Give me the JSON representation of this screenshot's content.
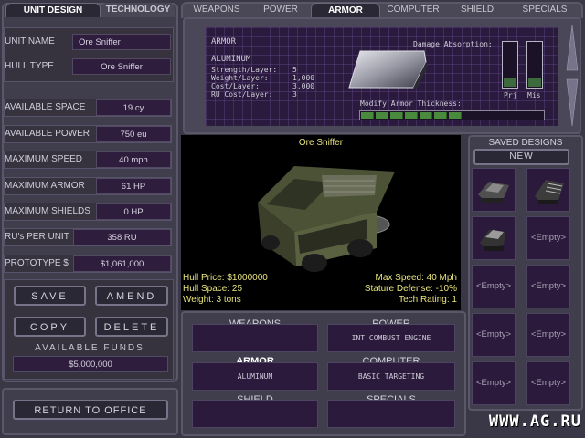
{
  "left": {
    "tab_active": "UNIT DESIGN",
    "tab_inactive": "TECHNOLOGY",
    "unit_name_label": "UNIT NAME",
    "unit_name_value": "Ore Sniffer",
    "hull_type_label": "HULL TYPE",
    "hull_type_value": "Ore Sniffer",
    "stats": [
      {
        "label": "AVAILABLE SPACE",
        "value": "19 cy"
      },
      {
        "label": "AVAILABLE POWER",
        "value": "750 eu"
      },
      {
        "label": "MAXIMUM SPEED",
        "value": "40 mph"
      },
      {
        "label": "MAXIMUM ARMOR",
        "value": "61 HP"
      },
      {
        "label": "MAXIMUM SHIELDS",
        "value": "0 HP"
      },
      {
        "label": "RU's PER UNIT",
        "value": "358 RU"
      },
      {
        "label": "PROTOTYPE $",
        "value": "$1,061,000"
      }
    ],
    "save": "SAVE",
    "amend": "AMEND",
    "copy": "COPY",
    "delete": "DELETE",
    "funds_label": "AVAILABLE FUNDS",
    "funds_value": "$5,000,000",
    "return": "RETURN TO OFFICE"
  },
  "tabs": [
    "WEAPONS",
    "POWER",
    "ARMOR",
    "COMPUTER",
    "SHIELD",
    "SPECIALS"
  ],
  "armor": {
    "heading": "ARMOR",
    "name": "ALUMINUM",
    "props": [
      {
        "label": "Strength/Layer:",
        "value": "5"
      },
      {
        "label": "Weight/Layer:",
        "value": "1,000"
      },
      {
        "label": "Cost/Layer:",
        "value": "3,000"
      },
      {
        "label": "RU Cost/Layer:",
        "value": "3"
      }
    ],
    "damage_label": "Damage Absorption:",
    "prj_label": "Prj",
    "mis_label": "Mis",
    "thickness_label": "Modify Armor Thickness:",
    "thickness_fraction": 0.6
  },
  "viewer": {
    "unit_title": "Ore Sniffer",
    "hull_price": "Hull Price: $1000000",
    "hull_space": "Hull Space: 25",
    "weight": "Weight: 3 tons",
    "max_speed": "Max Speed: 40 Mph",
    "stature": "Stature Defense: -10%",
    "tech": "Tech Rating: 1"
  },
  "components": {
    "weapons": {
      "title": "WEAPONS",
      "value": ""
    },
    "power": {
      "title": "POWER",
      "value": "INT COMBUST ENGINE"
    },
    "armor": {
      "title": "ARMOR",
      "value": "ALUMINUM"
    },
    "computer": {
      "title": "COMPUTER",
      "value": "BASIC TARGETING"
    },
    "shield": {
      "title": "SHIELD",
      "value": ""
    },
    "specials": {
      "title": "SPECIALS",
      "value": ""
    }
  },
  "saved": {
    "title": "SAVED DESIGNS",
    "new": "NEW",
    "empty": "<Empty>"
  },
  "watermark": "WWW.AG.RU"
}
